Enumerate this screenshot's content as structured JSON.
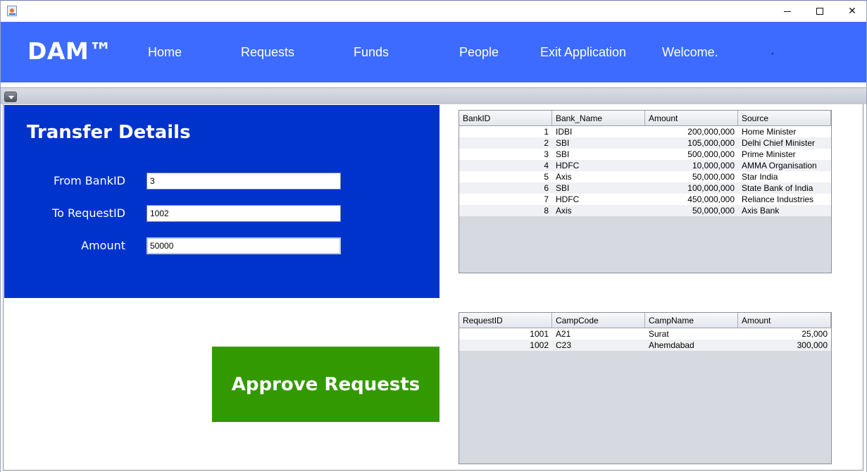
{
  "window": {
    "minimize_icon": "minimize-icon",
    "maximize_icon": "maximize-icon",
    "close_glyph": "✕",
    "app_icon": "java-app-icon"
  },
  "nav": {
    "brand": "DAM™",
    "items": [
      "Home",
      "Requests",
      "Funds",
      "People",
      "Exit Application",
      "Welcome."
    ]
  },
  "transfer": {
    "title": "Transfer Details",
    "from_bank_label": "From BankID",
    "from_bank_value": "3",
    "to_request_label": "To RequestID",
    "to_request_value": "1002",
    "amount_label": "Amount",
    "amount_value": "50000"
  },
  "approve_button": "Approve Requests",
  "banks_table": {
    "columns": [
      "BankID",
      "Bank_Name",
      "Amount",
      "Source"
    ],
    "rows": [
      [
        "1",
        "IDBI",
        "200,000,000",
        "Home Minister"
      ],
      [
        "2",
        "SBI",
        "105,000,000",
        "Delhi Chief Minister"
      ],
      [
        "3",
        "SBI",
        "500,000,000",
        "Prime Minister"
      ],
      [
        "4",
        "HDFC",
        "10,000,000",
        "AMMA Organisation"
      ],
      [
        "5",
        "Axis",
        "50,000,000",
        "Star India"
      ],
      [
        "6",
        "SBI",
        "100,000,000",
        "State Bank of India"
      ],
      [
        "7",
        "HDFC",
        "450,000,000",
        "Reliance Industries"
      ],
      [
        "8",
        "Axis",
        "50,000,000",
        "Axis Bank"
      ]
    ]
  },
  "requests_table": {
    "columns": [
      "RequestID",
      "CampCode",
      "CampName",
      "Amount"
    ],
    "rows": [
      [
        "1001",
        "A21",
        "Surat",
        "25,000"
      ],
      [
        "1002",
        "C23",
        "Ahemdabad",
        "300,000"
      ]
    ]
  },
  "colors": {
    "navbar": "#3d6bff",
    "transfer_panel": "#0033cc",
    "approve_button": "#339900"
  }
}
